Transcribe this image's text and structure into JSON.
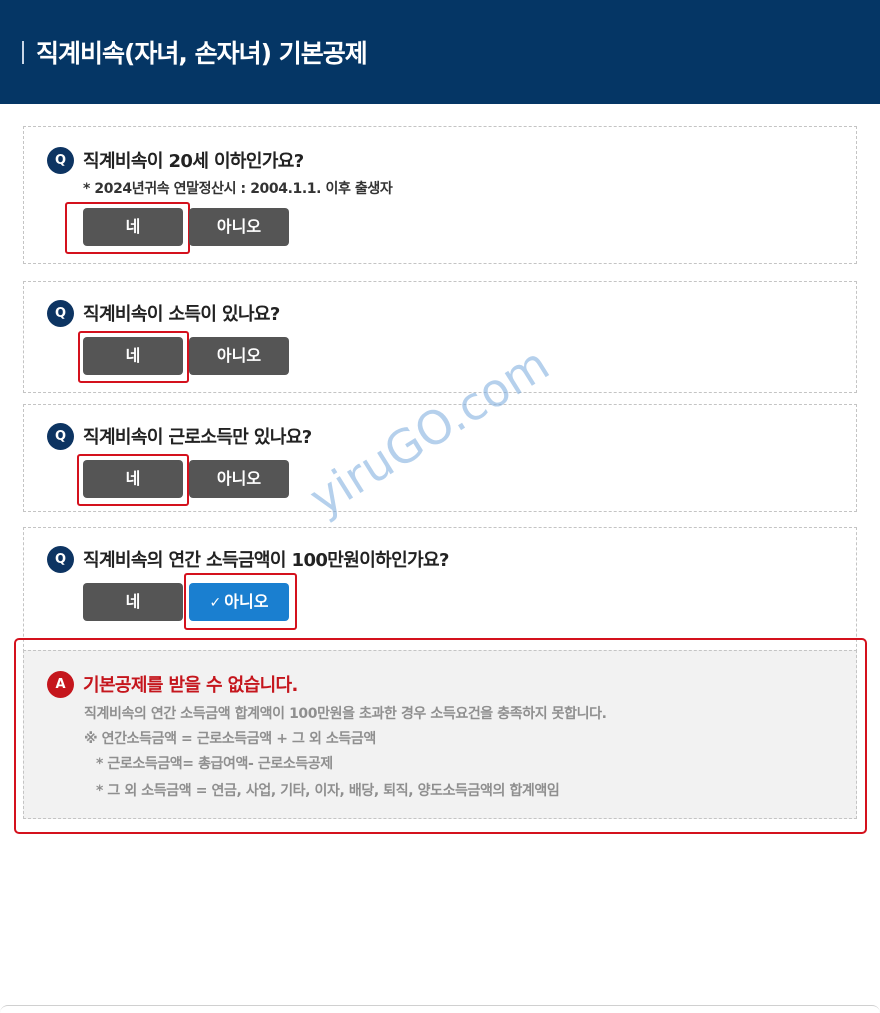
{
  "header": {
    "title": "직계비속(자녀, 손자녀) 기본공제"
  },
  "questions": [
    {
      "badge": "Q",
      "text": "직계비속이 20세 이하인가요?",
      "note": "* 2024년귀속 연말정산시 : 2004.1.1. 이후 출생자",
      "yes_label": "네",
      "no_label": "아니오",
      "selected": "yes"
    },
    {
      "badge": "Q",
      "text": "직계비속이 소득이 있나요?",
      "yes_label": "네",
      "no_label": "아니오",
      "selected": "yes"
    },
    {
      "badge": "Q",
      "text": "직계비속이 근로소득만 있나요?",
      "yes_label": "네",
      "no_label": "아니오",
      "selected": "yes"
    },
    {
      "badge": "Q",
      "text": "직계비속의 연간 소득금액이 100만원이하인가요?",
      "yes_label": "네",
      "no_label": "아니오",
      "selected": "no"
    }
  ],
  "answer": {
    "badge": "A",
    "title": "기본공제를 받을 수 없습니다.",
    "lines": [
      "직계비속의 연간 소득금액 합계액이 100만원을 초과한 경우 소득요건을 충족하지 못합니다.",
      "※ 연간소득금액 = 근로소득금액 + 그 외 소득금액",
      "* 근로소득금액= 총급여액- 근로소득공제",
      "* 그 외 소득금액 = 연금, 사업, 기타, 이자, 배당, 퇴직, 양도소득금액의 합계액임"
    ]
  },
  "watermark": "yiruGO.com",
  "colors": {
    "header_bg": "#053665",
    "button_default": "#555555",
    "button_selected": "#1a7fd0",
    "highlight_red": "#d4111d",
    "answer_red": "#c5161d",
    "q_badge": "#0d3462"
  }
}
